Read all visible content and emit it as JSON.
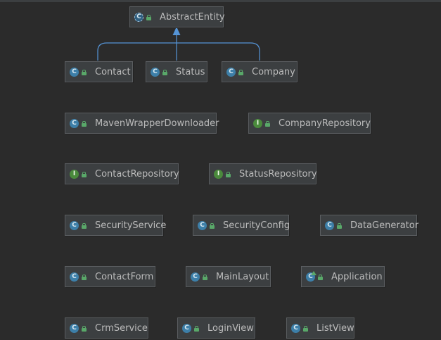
{
  "diagram": {
    "root": {
      "id": "abstract-entity",
      "name": "AbstractEntity",
      "kind": "abstract"
    },
    "nodes": [
      {
        "id": "contact",
        "name": "Contact",
        "kind": "class"
      },
      {
        "id": "status",
        "name": "Status",
        "kind": "class"
      },
      {
        "id": "company",
        "name": "Company",
        "kind": "class"
      },
      {
        "id": "maven-wrapper-downloader",
        "name": "MavenWrapperDownloader",
        "kind": "class"
      },
      {
        "id": "company-repository",
        "name": "CompanyRepository",
        "kind": "interface"
      },
      {
        "id": "contact-repository",
        "name": "ContactRepository",
        "kind": "interface"
      },
      {
        "id": "status-repository",
        "name": "StatusRepository",
        "kind": "interface"
      },
      {
        "id": "security-service",
        "name": "SecurityService",
        "kind": "class"
      },
      {
        "id": "security-config",
        "name": "SecurityConfig",
        "kind": "class"
      },
      {
        "id": "data-generator",
        "name": "DataGenerator",
        "kind": "class"
      },
      {
        "id": "contact-form",
        "name": "ContactForm",
        "kind": "class"
      },
      {
        "id": "main-layout",
        "name": "MainLayout",
        "kind": "class"
      },
      {
        "id": "application",
        "name": "Application",
        "kind": "app"
      },
      {
        "id": "crm-service",
        "name": "CrmService",
        "kind": "class"
      },
      {
        "id": "login-view",
        "name": "LoginView",
        "kind": "class"
      },
      {
        "id": "list-view",
        "name": "ListView",
        "kind": "class"
      }
    ],
    "inherits": [
      "contact",
      "status",
      "company"
    ],
    "colors": {
      "background": "#2b2b2b",
      "node": "#3c3f41",
      "edge": "#5594d6",
      "class_icon": "#3d7fa8",
      "interface_icon": "#4a8a3c",
      "text": "#bbbbbb"
    }
  }
}
